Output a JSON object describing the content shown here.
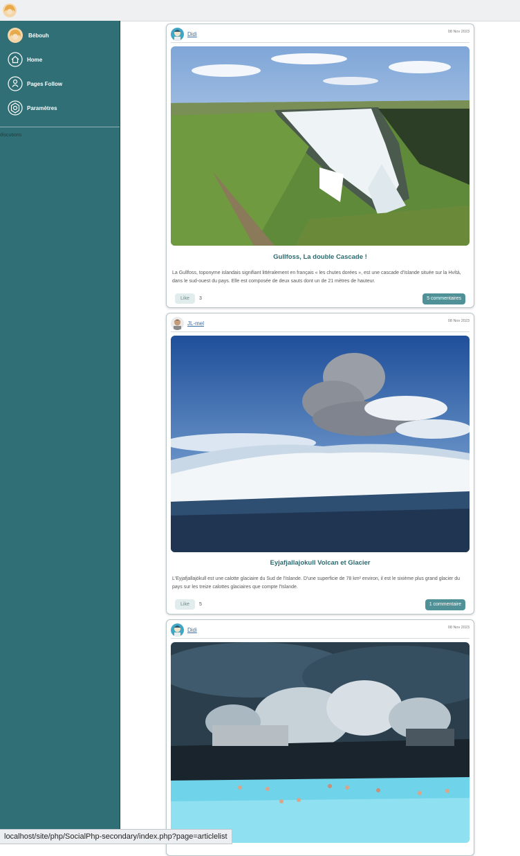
{
  "topbar": {
    "avatar": "user-avatar"
  },
  "sidebar": {
    "items": [
      {
        "label": "Bébouh",
        "icon": "user-avatar"
      },
      {
        "label": "Home",
        "icon": "home-icon"
      },
      {
        "label": "Pages Follow",
        "icon": "pages-follow-icon"
      },
      {
        "label": "Paramètres",
        "icon": "settings-icon"
      }
    ],
    "section_label": "discutions"
  },
  "posts": [
    {
      "author": "Didi",
      "date": "08 Nov 2023",
      "title": "Gullfoss, La double Cascade !",
      "description": "La Gullfoss, toponyme islandais signifiant littéralement en français « les chutes dorées », est une cascade d'Islande située sur la Hvítá, dans le sud-ouest du pays. Elle est composée de deux sauts dont un de 21 mètres de hauteur.",
      "like_label": "Like",
      "likes": "3",
      "comments_label": "5 commentaires"
    },
    {
      "author": "JL-mel",
      "date": "08 Nov 2023",
      "title": "Eyjafjallajokull Volcan et Glacier",
      "description": "L'Eyjafjallajökull est une calotte glaciaire du Sud de l'Islande. D'une superficie de 78 km² environ, il est le sixième plus grand glacier du pays sur les treize calottes glaciaires que compte l'Islande.",
      "like_label": "Like",
      "likes": "5",
      "comments_label": "1 commentaire"
    },
    {
      "author": "Didi",
      "date": "08 Nov 2023"
    }
  ],
  "status_url": "localhost/site/php/SocialPhp-secondary/index.php?page=articlelist",
  "colors": {
    "sidebar": "#2f6f75",
    "accent": "#4f9196",
    "title": "#2a6a6e"
  }
}
